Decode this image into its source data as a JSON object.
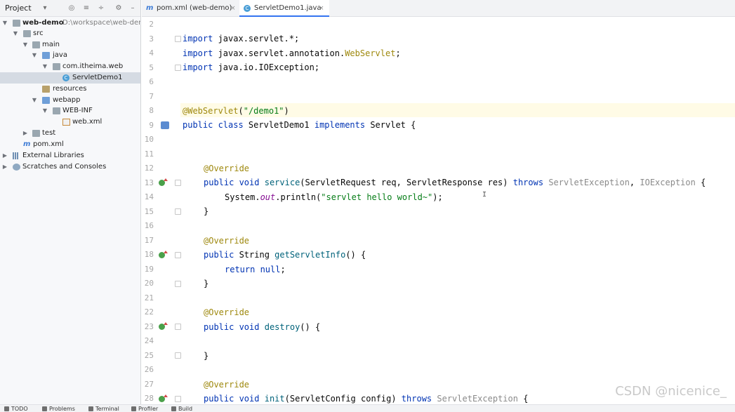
{
  "project_panel": {
    "title": "Project",
    "tree": [
      {
        "name": "web-demo",
        "path": "D:\\workspace\\web-dem",
        "bold": true
      },
      {
        "name": "src"
      },
      {
        "name": "main"
      },
      {
        "name": "java"
      },
      {
        "name": "com.itheima.web"
      },
      {
        "name": "ServletDemo1"
      },
      {
        "name": "resources"
      },
      {
        "name": "webapp"
      },
      {
        "name": "WEB-INF"
      },
      {
        "name": "web.xml"
      },
      {
        "name": "test"
      },
      {
        "name": "pom.xml"
      },
      {
        "name": "External Libraries"
      },
      {
        "name": "Scratches and Consoles"
      }
    ]
  },
  "tabs": [
    {
      "label": "pom.xml (web-demo)",
      "close": "×"
    },
    {
      "label": "ServletDemo1.java",
      "close": "×"
    }
  ],
  "editor": {
    "line_numbers": [
      "2",
      "3",
      "4",
      "5",
      "6",
      "7",
      "8",
      "9",
      "10",
      "11",
      "12",
      "13",
      "14",
      "15",
      "16",
      "17",
      "18",
      "19",
      "20",
      "21",
      "22",
      "23",
      "24",
      "25",
      "26",
      "27",
      "28"
    ],
    "code": {
      "l3_import": "import",
      "l3_rest": " javax.servlet.*;",
      "l4_import": "import",
      "l4_rest": " javax.servlet.annotation.",
      "l4_cls": "WebServlet",
      "l4_end": ";",
      "l5_import": "import",
      "l5_rest": " java.io.IOException;",
      "l8_ann": "@WebServlet",
      "l8_p1": "(",
      "l8_str": "\"/demo1\"",
      "l8_p2": ")",
      "l9_kw": "public class",
      "l9_name": " ServletDemo1 ",
      "l9_impl": "implements",
      "l9_rest": " Servlet {",
      "l12_ann": "@Override",
      "l13_kw": "public void",
      "l13_m": "service",
      "l13_params": "(ServletRequest req, ServletResponse res) ",
      "l13_throws": "throws",
      "l13_ex1": " ServletException",
      "l13_comma": ", ",
      "l13_ex2": "IOException",
      "l13_end": " {",
      "l14_a": "System.",
      "l14_out": "out",
      "l14_b": ".println(",
      "l14_str": "\"servlet hello world~\"",
      "l14_c": ");",
      "l15": "}",
      "l17_ann": "@Override",
      "l18_kw": "public",
      "l18_type": " String ",
      "l18_m": "getServletInfo",
      "l18_rest": "() {",
      "l19_kw": "return null",
      "l19_end": ";",
      "l20": "}",
      "l22_ann": "@Override",
      "l23_kw": "public void",
      "l23_m": "destroy",
      "l23_rest": "() {",
      "l25": "}",
      "l27_ann": "@Override",
      "l28_kw": "public void",
      "l28_m": "init",
      "l28_params": "(ServletConfig config) ",
      "l28_throws": "throws",
      "l28_ex": " ServletException",
      "l28_end": " {"
    }
  },
  "watermark": "CSDN @nicenice_",
  "bottom_bar": [
    "TODO",
    "Problems",
    "Terminal",
    "Profiler",
    "Build"
  ],
  "colors": {
    "keyword": "#0033b3",
    "annotation": "#9e880d",
    "string": "#067d17",
    "method": "#00627a",
    "accent": "#3574f0"
  }
}
